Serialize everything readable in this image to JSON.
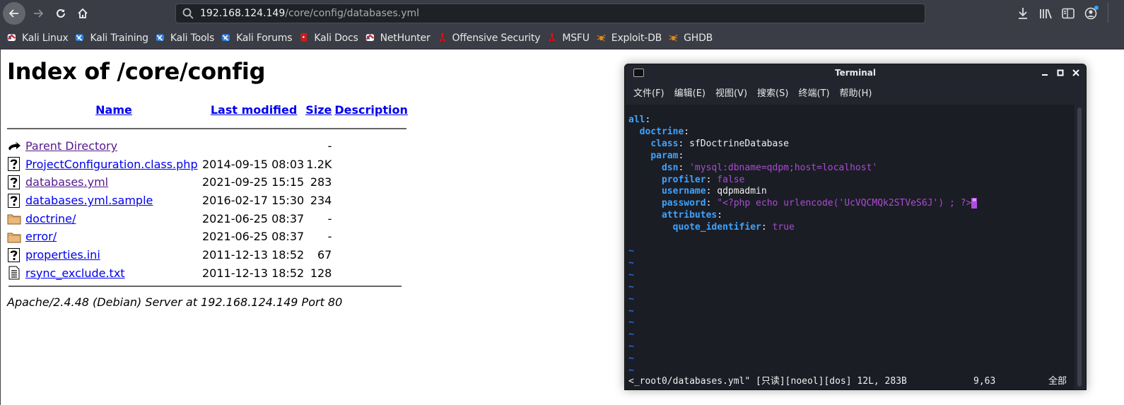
{
  "browser": {
    "url_host": "192.168.124.149",
    "url_path": "/core/config/databases.yml",
    "nav": {
      "back": "back-arrow-icon",
      "forward": "forward-arrow-icon",
      "reload": "reload-icon",
      "home": "home-icon"
    },
    "right_icons": [
      "download-icon",
      "library-icon",
      "sidebar-icon",
      "account-icon"
    ],
    "bookmarks": [
      {
        "label": "Kali Linux",
        "icon": "kali-dragon-red-icon"
      },
      {
        "label": "Kali Training",
        "icon": "kali-dragon-blue-icon"
      },
      {
        "label": "Kali Tools",
        "icon": "kali-dragon-blue-icon"
      },
      {
        "label": "Kali Forums",
        "icon": "kali-dragon-blue-icon"
      },
      {
        "label": "Kali Docs",
        "icon": "kali-docs-red-icon"
      },
      {
        "label": "NetHunter",
        "icon": "kali-dragon-red-icon"
      },
      {
        "label": "Offensive Security",
        "icon": "offsec-red-icon"
      },
      {
        "label": "MSFU",
        "icon": "offsec-red-icon"
      },
      {
        "label": "Exploit-DB",
        "icon": "exploitdb-spider-icon"
      },
      {
        "label": "GHDB",
        "icon": "exploitdb-spider-icon"
      }
    ]
  },
  "page": {
    "title": "Index of /core/config",
    "columns": {
      "name": "Name",
      "last_modified": "Last modified",
      "size": "Size",
      "description": "Description"
    },
    "entries": [
      {
        "icon": "back-folder-icon",
        "name": "Parent Directory",
        "modified": "",
        "size": "-",
        "visited": true
      },
      {
        "icon": "unknown-file-icon",
        "name": "ProjectConfiguration.class.php",
        "modified": "2014-09-15 08:03",
        "size": "1.2K",
        "visited": false
      },
      {
        "icon": "unknown-file-icon",
        "name": "databases.yml",
        "modified": "2021-09-25 15:15",
        "size": "283",
        "visited": true
      },
      {
        "icon": "unknown-file-icon",
        "name": "databases.yml.sample",
        "modified": "2016-02-17 15:30",
        "size": "234",
        "visited": false
      },
      {
        "icon": "folder-icon",
        "name": "doctrine/",
        "modified": "2021-06-25 08:37",
        "size": "-",
        "visited": false
      },
      {
        "icon": "folder-icon",
        "name": "error/",
        "modified": "2021-06-25 08:37",
        "size": "-",
        "visited": false
      },
      {
        "icon": "unknown-file-icon",
        "name": "properties.ini",
        "modified": "2011-12-13 18:52",
        "size": "67",
        "visited": false
      },
      {
        "icon": "text-file-icon",
        "name": "rsync_exclude.txt",
        "modified": "2011-12-13 18:52",
        "size": "128",
        "visited": false
      }
    ],
    "address": "Apache/2.4.48 (Debian) Server at 192.168.124.149 Port 80"
  },
  "terminal": {
    "title": "Terminal",
    "menu": [
      "文件(F)",
      "编辑(E)",
      "视图(V)",
      "搜索(S)",
      "终端(T)",
      "帮助(H)"
    ],
    "yaml": {
      "all": "all",
      "doctrine": "doctrine",
      "class_key": "class",
      "class_val": "sfDoctrineDatabase",
      "param": "param",
      "dsn_key": "dsn",
      "dsn_val": "'mysql:dbname=qdpm;host=localhost'",
      "profiler_key": "profiler",
      "profiler_val": "false",
      "username_key": "username",
      "username_val": "qdpmadmin",
      "password_key": "password",
      "password_val": "\"<?php echo urlencode('UcVQCMQk2STVeS6J') ; ?>",
      "password_cursor": "\"",
      "attributes_key": "attributes",
      "quote_key": "quote_identifier",
      "quote_val": "true"
    },
    "tilde_lines": 11,
    "status": {
      "file": "<_root0/databases.yml\" [只读][noeol][dos] 12L, 283B",
      "position": "9,63",
      "scroll": "全部"
    }
  }
}
